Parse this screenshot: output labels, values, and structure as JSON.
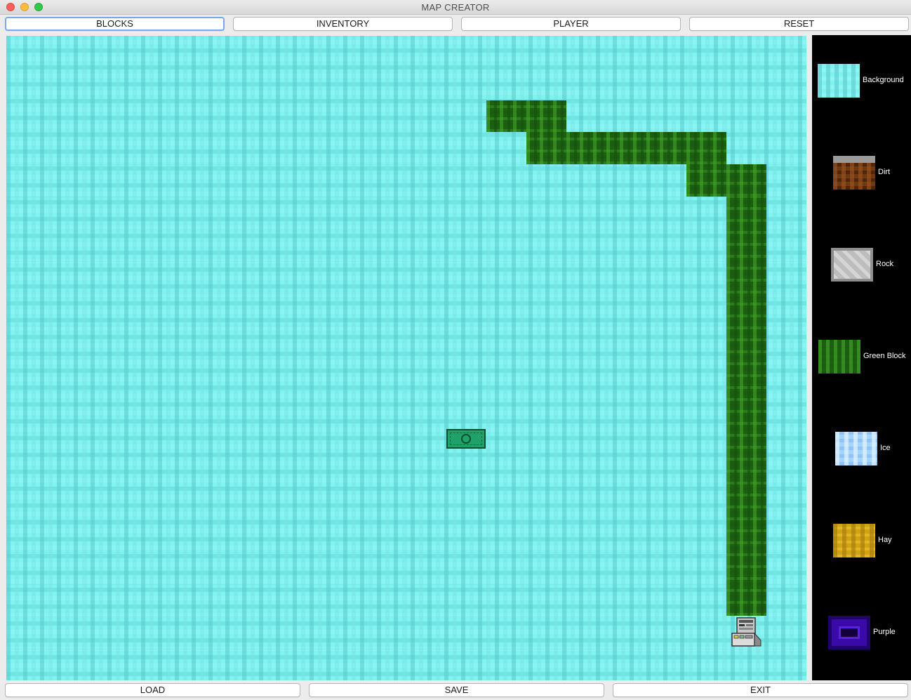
{
  "window": {
    "title": "MAP CREATOR"
  },
  "top_buttons": {
    "blocks": "BLOCKS",
    "inventory": "INVENTORY",
    "player": "PLAYER",
    "reset": "RESET"
  },
  "bottom_buttons": {
    "load": "LOAD",
    "save": "SAVE",
    "exit": "EXIT"
  },
  "palette": {
    "items": [
      {
        "label": "Background",
        "icon": "background-tile-icon"
      },
      {
        "label": "Dirt",
        "icon": "dirt-tile-icon"
      },
      {
        "label": "Rock",
        "icon": "rock-tile-icon"
      },
      {
        "label": "Green Block",
        "icon": "green-block-tile-icon"
      },
      {
        "label": "Ice",
        "icon": "ice-tile-icon"
      },
      {
        "label": "Hay",
        "icon": "hay-tile-icon"
      },
      {
        "label": "Purple",
        "icon": "purple-tile-icon"
      }
    ]
  },
  "map": {
    "placed_items": [
      "money-icon",
      "computer-icon"
    ]
  },
  "colors": {
    "background_tile": "#7ff3ef",
    "green_block": "#1c5e12",
    "palette_bg": "#000000",
    "focus_ring": "#7aa7ef"
  }
}
